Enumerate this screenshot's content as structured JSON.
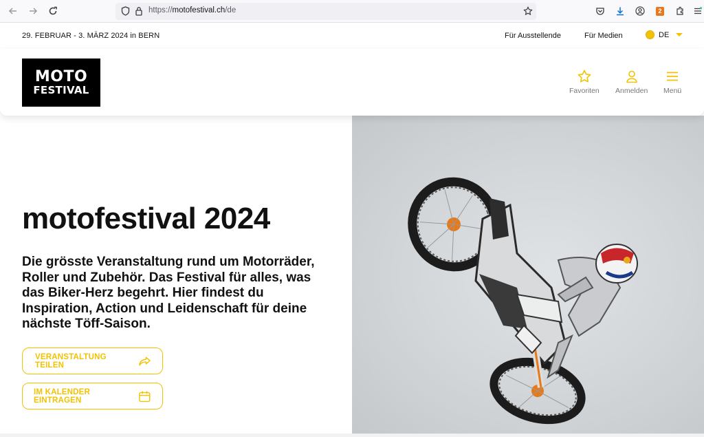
{
  "browser": {
    "url_prefix": "https://",
    "url_domain": "motofestival.ch",
    "url_path": "/de",
    "badge_count": "2"
  },
  "topbar": {
    "date": "29. FEBRUAR - 3. MÄRZ 2024 in BERN",
    "exhibitors": "Für Ausstellende",
    "media": "Für Medien",
    "language": "DE"
  },
  "header": {
    "logo_line1": "MOTO",
    "logo_line2": "FESTIVAL",
    "favorites": "Favoriten",
    "login": "Anmelden",
    "menu": "Menü"
  },
  "hero": {
    "title": "motofestival 2024",
    "subtitle": "Die grösste Veranstaltung rund um Motorräder, Roller und Zubehör. Das Festival für alles, was das Biker-Herz begehrt. Hier findest du Inspiration, Action und Leidenschaft für deine nächste Töff-Saison.",
    "share_button": "VERANSTALTUNG TEILEN",
    "calendar_button": "IM KALENDER EINTRAGEN"
  },
  "colors": {
    "accent": "#f2c200",
    "text": "#111111"
  }
}
